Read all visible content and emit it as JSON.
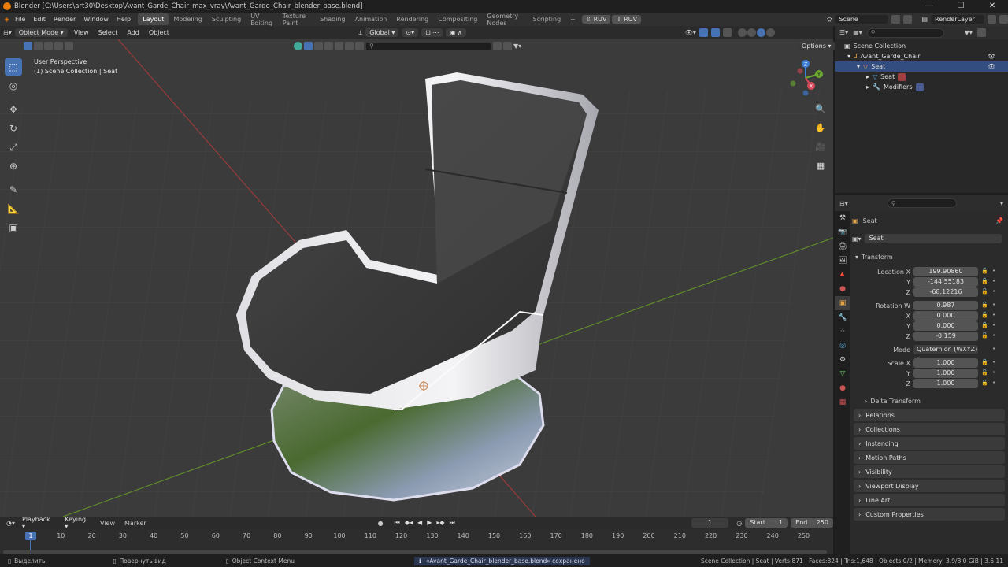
{
  "window": {
    "title": "Blender [C:\\Users\\art30\\Desktop\\Avant_Garde_Chair_max_vray\\Avant_Garde_Chair_blender_base.blend]",
    "controls": [
      "—",
      "☐",
      "✕"
    ]
  },
  "menu": {
    "items": [
      "File",
      "Edit",
      "Render",
      "Window",
      "Help"
    ],
    "workspaces": [
      "Layout",
      "Modeling",
      "Sculpting",
      "UV Editing",
      "Texture Paint",
      "Shading",
      "Animation",
      "Rendering",
      "Compositing",
      "Geometry Nodes",
      "Scripting"
    ],
    "active_workspace": "Layout",
    "ruv1": "RUV",
    "ruv2": "RUV",
    "scene": "Scene",
    "render_layer": "RenderLayer"
  },
  "viewport_header": {
    "mode": "Object Mode",
    "menus": [
      "View",
      "Select",
      "Add",
      "Object"
    ],
    "orientation": "Global",
    "options_label": "Options"
  },
  "viewport": {
    "perspective": "User Perspective",
    "collection_info": "(1) Scene Collection | Seat",
    "gizmo_axes": [
      "X",
      "Y",
      "Z"
    ]
  },
  "outliner": {
    "rows": [
      {
        "label": "Scene Collection",
        "indent": 0
      },
      {
        "label": "Avant_Garde_Chair",
        "indent": 1
      },
      {
        "label": "Seat",
        "indent": 2
      },
      {
        "label": "Seat",
        "indent": 3
      },
      {
        "label": "Modifiers",
        "indent": 3
      }
    ]
  },
  "properties": {
    "object_name": "Seat",
    "data_name": "Seat",
    "transform_title": "Transform",
    "location": {
      "label": "Location X",
      "x": "199.90860",
      "y": "-144.55183",
      "z": "-68.12216"
    },
    "rotation": {
      "label": "Rotation W",
      "w": "0.987",
      "x": "0.000",
      "y": "0.000",
      "z": "-0.159"
    },
    "mode_label": "Mode",
    "mode_value": "Quaternion (WXYZ)",
    "scale": {
      "label": "Scale X",
      "x": "1.000",
      "y": "1.000",
      "z": "1.000"
    },
    "axis_labels": [
      "X",
      "Y",
      "Z"
    ],
    "delta": "Delta Transform",
    "panels": [
      "Relations",
      "Collections",
      "Instancing",
      "Motion Paths",
      "Visibility",
      "Viewport Display",
      "Line Art",
      "Custom Properties"
    ]
  },
  "timeline": {
    "menus": [
      "Playback",
      "Keying",
      "View",
      "Marker"
    ],
    "current_frame": "1",
    "start_label": "Start",
    "start": "1",
    "end_label": "End",
    "end": "250",
    "ticks": [
      "10",
      "20",
      "30",
      "40",
      "50",
      "60",
      "70",
      "80",
      "90",
      "100",
      "110",
      "120",
      "130",
      "140",
      "150",
      "160",
      "170",
      "180",
      "190",
      "200",
      "210",
      "220",
      "230",
      "240",
      "250"
    ],
    "frame_badge": "1"
  },
  "status": {
    "select": "Выделить",
    "rotate": "Повернуть вид",
    "context": "Object Context Menu",
    "message": "«Avant_Garde_Chair_blender_base.blend» сохранено",
    "stats": "Scene Collection | Seat | Verts:871 | Faces:824 | Tris:1,648 | Objects:0/2 | Memory: 3.9/8.0 GiB | 3.6.11"
  }
}
